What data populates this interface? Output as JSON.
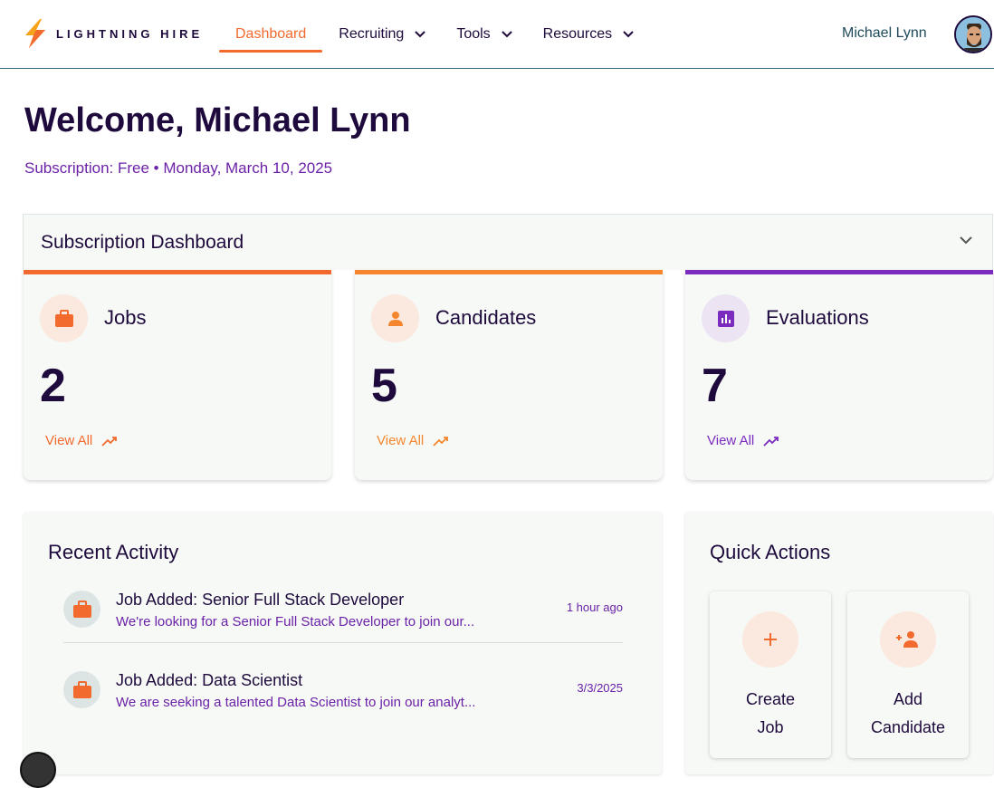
{
  "brand": {
    "name": "LIGHTNING HIRE"
  },
  "nav": {
    "items": [
      {
        "label": "Dashboard",
        "active": true
      },
      {
        "label": "Recruiting",
        "dropdown": true
      },
      {
        "label": "Tools",
        "dropdown": true
      },
      {
        "label": "Resources",
        "dropdown": true
      }
    ],
    "user_name": "Michael Lynn"
  },
  "header": {
    "welcome": "Welcome, Michael Lynn",
    "subscription_line": "Subscription: Free • Monday, March 10, 2025"
  },
  "subscription_dashboard": {
    "title": "Subscription Dashboard",
    "cards": [
      {
        "title": "Jobs",
        "value": "2",
        "link": "View All",
        "icon": "briefcase-icon",
        "accent": "#f26a2e"
      },
      {
        "title": "Candidates",
        "value": "5",
        "link": "View All",
        "icon": "person-icon",
        "accent": "#f5862e"
      },
      {
        "title": "Evaluations",
        "value": "7",
        "link": "View All",
        "icon": "bar-chart-icon",
        "accent": "#7b2cbf"
      }
    ]
  },
  "recent_activity": {
    "title": "Recent Activity",
    "items": [
      {
        "title": "Job Added: Senior Full Stack Developer",
        "description": "We're looking for a Senior Full Stack Developer to join our...",
        "time": "1 hour ago",
        "icon": "briefcase-icon"
      },
      {
        "title": "Job Added: Data Scientist",
        "description": "We are seeking a talented Data Scientist to join our analyt...",
        "time": "3/3/2025",
        "icon": "briefcase-icon"
      }
    ]
  },
  "quick_actions": {
    "title": "Quick Actions",
    "items": [
      {
        "label": "Create Job",
        "icon": "plus-icon"
      },
      {
        "label": "Add Candidate",
        "icon": "add-person-icon"
      }
    ]
  }
}
